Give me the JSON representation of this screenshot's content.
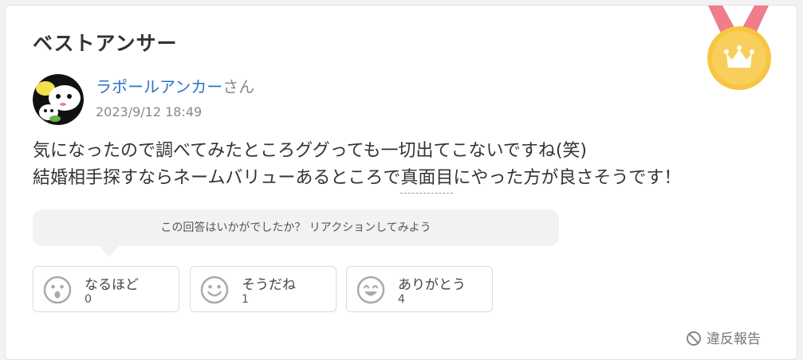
{
  "header": {
    "title": "ベストアンサー",
    "medal_icon": "crown-medal-icon"
  },
  "answer": {
    "user_name": "ラポールアンカー",
    "user_suffix": "さん",
    "timestamp": "2023/9/12 18:49",
    "line1": "気になったので調べてみたところググっても一切出てこないですね(笑)",
    "line2_before": "結婚相手探すならネームバリューあるところで",
    "line2_highlight": "真面目",
    "line2_after": "にやった方が良さそうです！"
  },
  "reaction_prompt": "この回答はいかがでしたか？ リアクションしてみよう",
  "reactions": [
    {
      "label": "なるほど",
      "count": "0",
      "icon": "surprised-face-icon"
    },
    {
      "label": "そうだね",
      "count": "1",
      "icon": "smile-face-icon"
    },
    {
      "label": "ありがとう",
      "count": "4",
      "icon": "grin-face-icon"
    }
  ],
  "report_label": "違反報告",
  "colors": {
    "accent_link": "#2a73c9",
    "medal_gold": "#f7c541",
    "ribbon": "#f07d8a"
  }
}
